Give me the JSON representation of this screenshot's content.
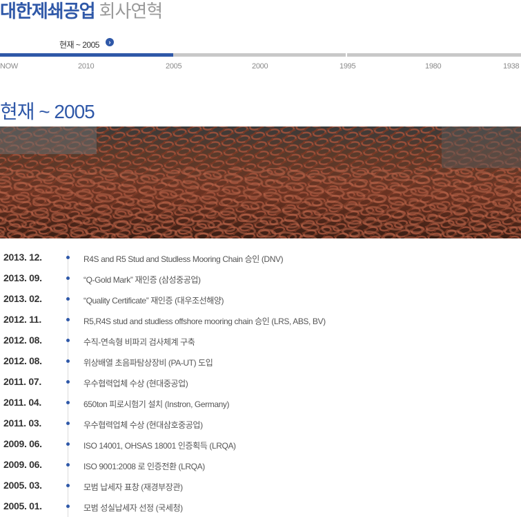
{
  "header": {
    "brand": "대한제쇄공업",
    "section": "회사연혁"
  },
  "timeline_nav": {
    "current_label": "현재 ~ 2005",
    "years": [
      "NOW",
      "2010",
      "2005",
      "2000",
      "1995",
      "1980",
      "1938"
    ],
    "active_color": "#2f58a8",
    "inactive_color": "#c8c8c8"
  },
  "era": {
    "heading": "현재 ~ 2005"
  },
  "history": [
    {
      "date": "2013. 12.",
      "text": "R4S and R5 Stud and Studless Mooring Chain 승인 (DNV)"
    },
    {
      "date": "2013. 09.",
      "text": "“Q-Gold Mark” 재인증 (삼성중공업)"
    },
    {
      "date": "2013. 02.",
      "text": "“Quality Certificate” 재인증 (대우조선해양)"
    },
    {
      "date": "2012. 11.",
      "text": "R5,R4S stud and studless offshore mooring chain 승인 (LRS, ABS, BV)"
    },
    {
      "date": "2012. 08.",
      "text": "수직-연속형 비파괴 검사체계 구축"
    },
    {
      "date": "2012. 08.",
      "text": "위상배열 초음파탐상장비 (PA-UT) 도입"
    },
    {
      "date": "2011. 07.",
      "text": "우수협력업체 수상 (현대중공업)"
    },
    {
      "date": "2011. 04.",
      "text": "650ton 피로시험기 설치 (Instron, Germany)"
    },
    {
      "date": "2011. 03.",
      "text": "우수협력업체 수상 (현대삼호중공업)"
    },
    {
      "date": "2009. 06.",
      "text": "ISO 14001, OHSAS 18001 인증획득 (LRQA)"
    },
    {
      "date": "2009. 06.",
      "text": "ISO 9001:2008 로 인증전환 (LRQA)"
    },
    {
      "date": "2005. 03.",
      "text": "모범 납세자 표창 (재경부장관)"
    },
    {
      "date": "2005. 01.",
      "text": "모범 성실납세자 선정 (국세청)"
    }
  ]
}
